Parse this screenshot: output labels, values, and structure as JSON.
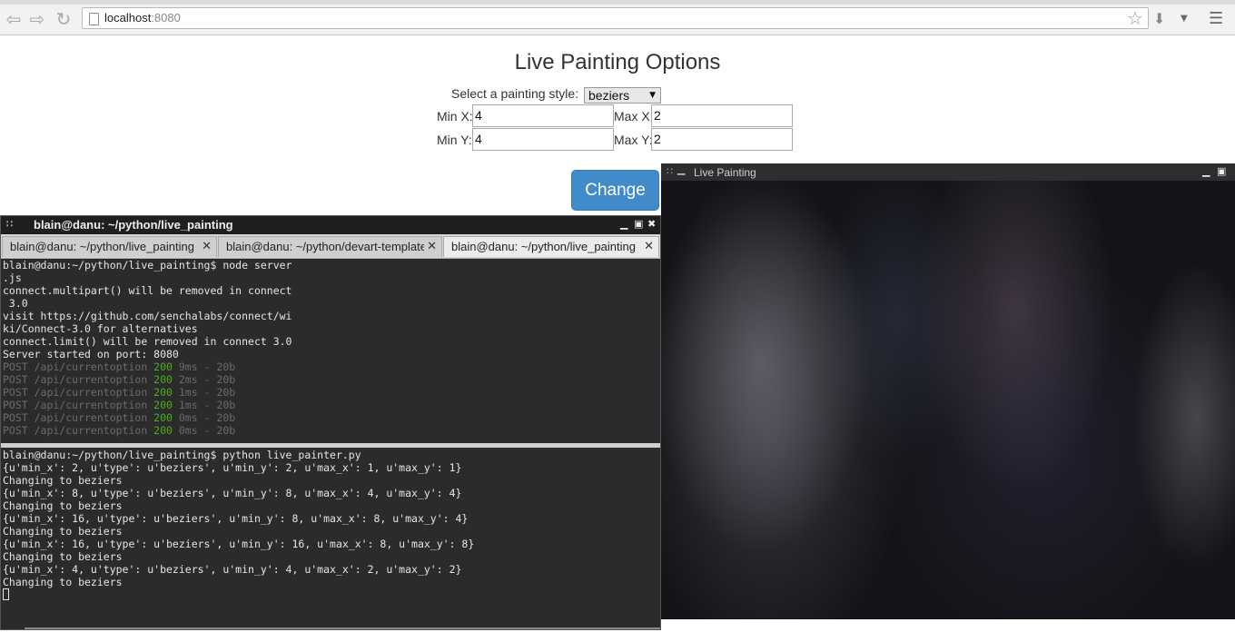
{
  "browser": {
    "url_host": "localhost",
    "url_port": ":8080",
    "icons": [
      "back-icon",
      "forward-icon",
      "reload-icon",
      "page-icon",
      "star-icon",
      "extension-icon",
      "dropdown-icon",
      "menu-icon"
    ]
  },
  "page": {
    "title": "Live Painting Options",
    "style_label": "Select a painting style:",
    "style_value": "beziers",
    "min_x_label": "Min X:",
    "min_x_value": "4",
    "max_x_label": "Max X:",
    "max_x_value": "2",
    "min_y_label": "Min Y:",
    "min_y_value": "4",
    "max_y_label": "Max Y:",
    "max_y_value": "2",
    "change_label": "Change",
    "button_color": "#428bca"
  },
  "terminal": {
    "title": "blain@danu: ~/python/live_painting",
    "tabs": [
      {
        "label": "blain@danu: ~/python/live_painting"
      },
      {
        "label": "blain@danu: ~/python/devart-template"
      },
      {
        "label": "blain@danu: ~/python/live_painting"
      }
    ],
    "pane1_lines": [
      "blain@danu:~/python/live_painting$ node server",
      ".js",
      "connect.multipart() will be removed in connect",
      " 3.0",
      "visit https://github.com/senchalabs/connect/wi",
      "ki/Connect-3.0 for alternatives",
      "connect.limit() will be removed in connect 3.0",
      "Server started on port: 8080"
    ],
    "post_lines": [
      {
        "path": "POST /api/currentoption ",
        "status": "200",
        "rest": " 9ms - 20b"
      },
      {
        "path": "POST /api/currentoption ",
        "status": "200",
        "rest": " 2ms - 20b"
      },
      {
        "path": "POST /api/currentoption ",
        "status": "200",
        "rest": " 1ms - 20b"
      },
      {
        "path": "POST /api/currentoption ",
        "status": "200",
        "rest": " 1ms - 20b"
      },
      {
        "path": "POST /api/currentoption ",
        "status": "200",
        "rest": " 0ms - 20b"
      },
      {
        "path": "POST /api/currentoption ",
        "status": "200",
        "rest": " 0ms - 20b"
      }
    ],
    "pane2_lines": [
      "blain@danu:~/python/live_painting$ python live_painter.py",
      "{u'min_x': 2, u'type': u'beziers', u'min_y': 2, u'max_x': 1, u'max_y': 1}",
      "Changing to beziers",
      "{u'min_x': 8, u'type': u'beziers', u'min_y': 8, u'max_x': 4, u'max_y': 4}",
      "Changing to beziers",
      "{u'min_x': 16, u'type': u'beziers', u'min_y': 8, u'max_x': 8, u'max_y': 4}",
      "Changing to beziers",
      "{u'min_x': 16, u'type': u'beziers', u'min_y': 16, u'max_x': 8, u'max_y': 8}",
      "Changing to beziers",
      "{u'min_x': 4, u'type': u'beziers', u'min_y': 4, u'max_x': 2, u'max_y': 2}",
      "Changing to beziers"
    ],
    "status_color": "#4caf1c"
  },
  "paint_window": {
    "title": "Live Painting"
  }
}
